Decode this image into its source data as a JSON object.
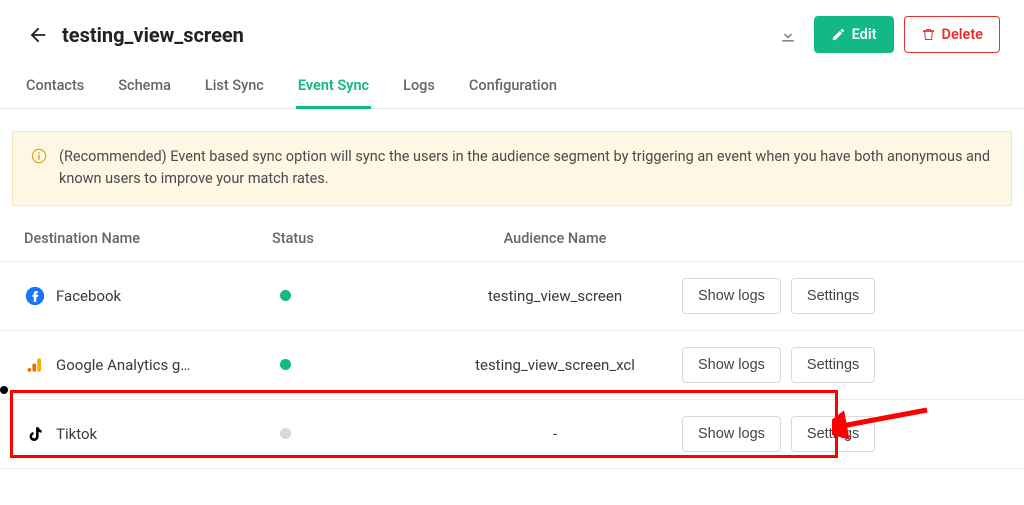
{
  "header": {
    "title": "testing_view_screen",
    "edit_label": "Edit",
    "delete_label": "Delete"
  },
  "tabs": [
    {
      "label": "Contacts",
      "active": false
    },
    {
      "label": "Schema",
      "active": false
    },
    {
      "label": "List Sync",
      "active": false
    },
    {
      "label": "Event Sync",
      "active": true
    },
    {
      "label": "Logs",
      "active": false
    },
    {
      "label": "Configuration",
      "active": false
    }
  ],
  "banner": {
    "text": "(Recommended) Event based sync option will sync the users in the audience segment by triggering an event when you have both anonymous and known users to improve your match rates."
  },
  "table": {
    "headers": {
      "destination": "Destination Name",
      "status": "Status",
      "audience": "Audience Name"
    },
    "action_labels": {
      "show_logs": "Show logs",
      "settings": "Settings"
    },
    "rows": [
      {
        "icon": "facebook",
        "name": "Facebook",
        "status": "active",
        "audience": "testing_view_screen"
      },
      {
        "icon": "ga",
        "name": "Google Analytics g…",
        "status": "active",
        "audience": "testing_view_screen_xcl"
      },
      {
        "icon": "tiktok",
        "name": "Tiktok",
        "status": "inactive",
        "audience": "-"
      }
    ]
  }
}
